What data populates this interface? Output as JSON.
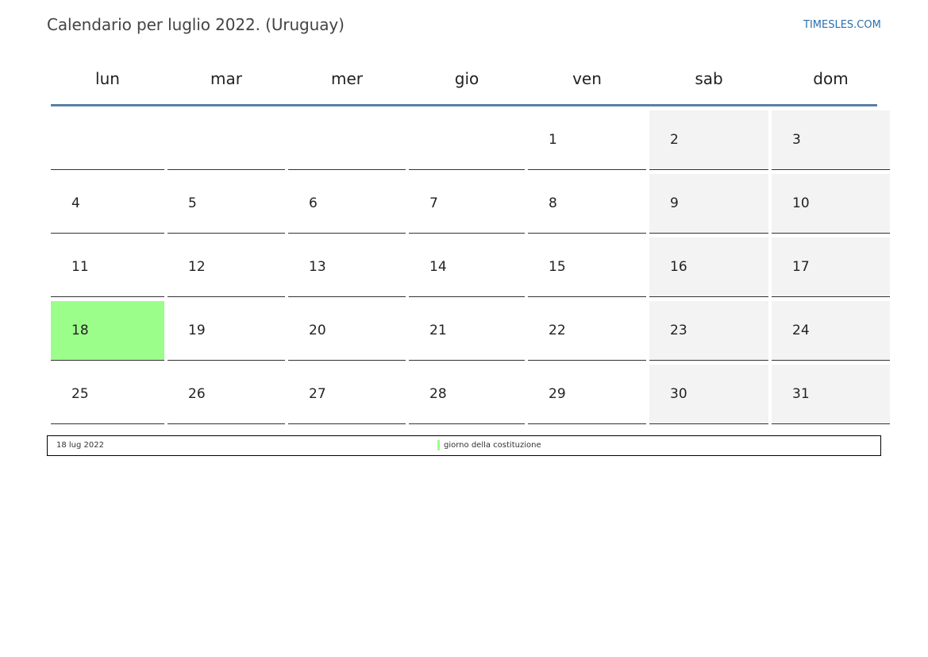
{
  "header": {
    "title": "Calendario per luglio 2022. (Uruguay)",
    "site": "TIMESLES.COM"
  },
  "colors": {
    "accent_line": "#5a7fa6",
    "weekend_bg": "#f3f3f3",
    "holiday_bg": "#9cfe8a",
    "link": "#2a6fb0"
  },
  "weekdays": [
    "lun",
    "mar",
    "mer",
    "gio",
    "ven",
    "sab",
    "dom"
  ],
  "weeks": [
    [
      "",
      "",
      "",
      "",
      "1",
      "2",
      "3"
    ],
    [
      "4",
      "5",
      "6",
      "7",
      "8",
      "9",
      "10"
    ],
    [
      "11",
      "12",
      "13",
      "14",
      "15",
      "16",
      "17"
    ],
    [
      "18",
      "19",
      "20",
      "21",
      "22",
      "23",
      "24"
    ],
    [
      "25",
      "26",
      "27",
      "28",
      "29",
      "30",
      "31"
    ]
  ],
  "holidays": [
    "18"
  ],
  "legend": {
    "date": "18 lug 2022",
    "name": "giorno della costituzione"
  }
}
